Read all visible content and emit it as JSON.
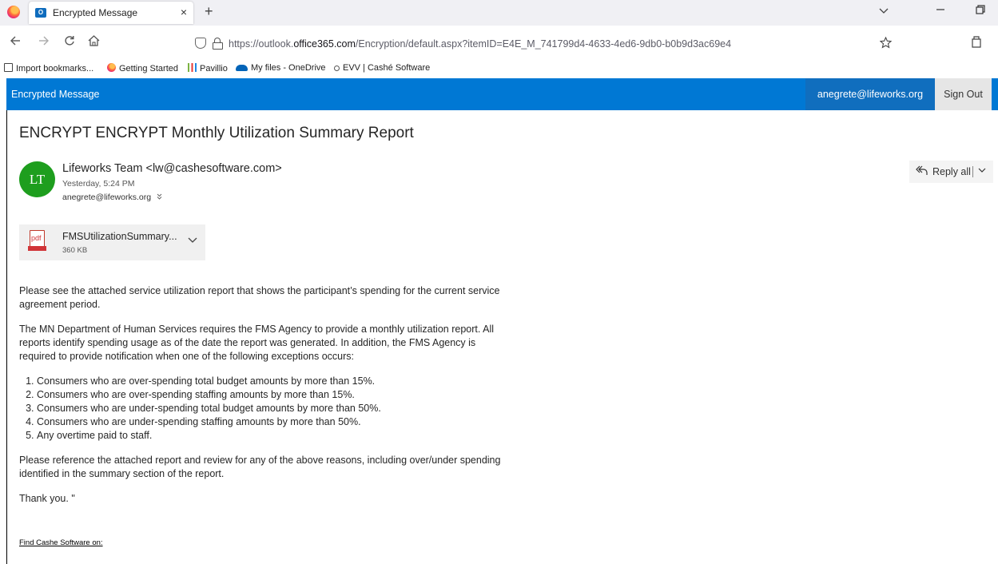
{
  "browser": {
    "tab_title": "Encrypted Message",
    "tab_icon_text": "O",
    "close_glyph": "×",
    "new_tab_glyph": "+",
    "url_prefix": "https://outlook.",
    "url_domain": "office365.com",
    "url_suffix": "/Encryption/default.aspx?itemID=E4E_M_741799d4-4633-4ed6-9db0-b0b9d3ac69e4",
    "bookmarks": [
      {
        "label": "Import bookmarks...",
        "icon": "import-icon"
      },
      {
        "label": "Getting Started",
        "icon": "firefox-icon"
      },
      {
        "label": "Pavillio",
        "icon": "pavillio-icon"
      },
      {
        "label": "My files - OneDrive",
        "icon": "onedrive-icon"
      },
      {
        "label": "EVV | Cashé Software",
        "icon": "evv-icon"
      }
    ]
  },
  "app": {
    "title": "Encrypted Message",
    "user": "anegrete@lifeworks.org",
    "sign_out": "Sign Out",
    "accent_color": "#0078d4"
  },
  "message": {
    "subject": "ENCRYPT ENCRYPT Monthly Utilization Summary Report",
    "avatar_initials": "LT",
    "sender": "Lifeworks Team <lw@cashesoftware.com>",
    "date": "Yesterday, 5:24 PM",
    "recipient": "anegrete@lifeworks.org",
    "reply_all_label": "Reply all",
    "attachment": {
      "name": "FMSUtilizationSummary...",
      "size": "360 KB",
      "icon_text": "pdf"
    },
    "body": {
      "p1": "Please see the attached service utilization report that shows the participant’s spending for the current service agreement period.",
      "p2": "The MN Department of Human Services requires the FMS Agency to provide a monthly utilization report. All reports identify spending usage as of the date the report was generated. In addition, the FMS Agency is required to provide notification when one of the following exceptions occurs:",
      "exceptions": [
        "Consumers who are over-spending total budget amounts by more than 15%.",
        "Consumers who are over-spending staffing amounts by more than 15%.",
        "Consumers who are under-spending total budget amounts by more than 50%.",
        "Consumers who are under-spending staffing amounts by more than 50%.",
        "Any overtime paid to staff."
      ],
      "p3": "Please reference the attached report and review for any of the above reasons, including over/under spending identified in the summary section of the report.",
      "thanks": "Thank you. \"",
      "footer_link": "Find Cashe Software on:"
    }
  }
}
